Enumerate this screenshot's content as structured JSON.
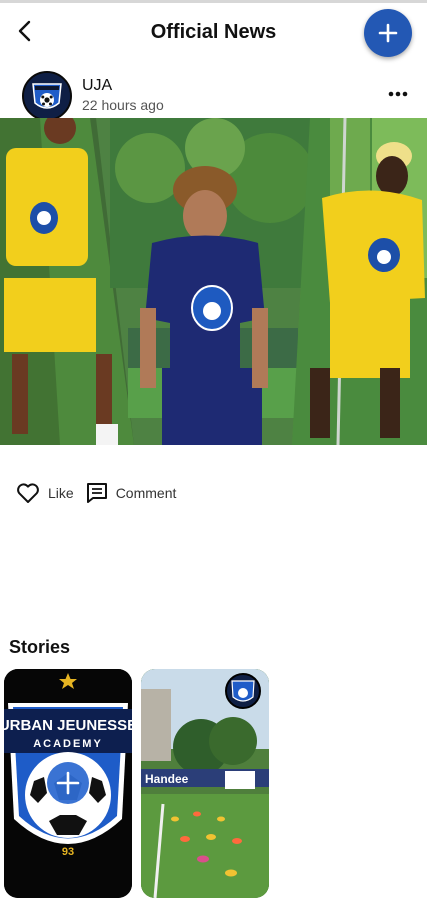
{
  "header": {
    "title": "Official News",
    "back_icon": "back-arrow-icon",
    "add_icon": "plus-icon",
    "accent_color": "#2358b4"
  },
  "post": {
    "author": "UJA",
    "time": "22 hours ago",
    "more_icon": "more-horizontal-icon",
    "image_description_icon": "photo-collage",
    "actions": {
      "like_label": "Like",
      "comment_label": "Comment"
    }
  },
  "stories": {
    "title": "Stories",
    "items": [
      {
        "kind": "add-story",
        "logo_text_line1": "URBAN JEUNESSE",
        "logo_text_line2": "ACADEMY",
        "logo_number": "93"
      },
      {
        "kind": "story",
        "banner_text": "Handee"
      }
    ]
  }
}
